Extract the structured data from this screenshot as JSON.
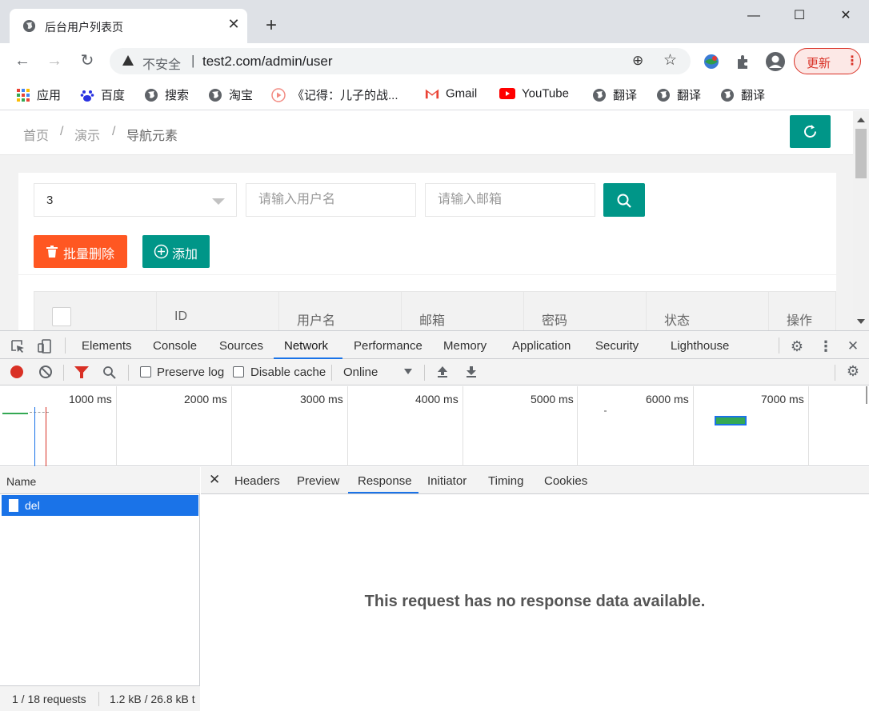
{
  "browser": {
    "tab_title": "后台用户列表页",
    "new_tab": "+",
    "window_controls": {
      "minimize": "—",
      "maximize": "☐",
      "close": "✕"
    },
    "security_label": "不安全",
    "url": "test2.com/admin/user",
    "update_label": "更新"
  },
  "bookmarks": [
    {
      "label": "应用",
      "icon": "apps-grid-icon"
    },
    {
      "label": "百度",
      "icon": "baidu-paw-icon"
    },
    {
      "label": "搜索",
      "icon": "globe-icon"
    },
    {
      "label": "淘宝",
      "icon": "globe-icon"
    },
    {
      "label": "《记得：儿子的战...",
      "icon": "play-circle-icon"
    },
    {
      "label": "Gmail",
      "icon": "gmail-icon"
    },
    {
      "label": "YouTube",
      "icon": "youtube-icon"
    },
    {
      "label": "翻译",
      "icon": "globe-icon"
    },
    {
      "label": "翻译",
      "icon": "globe-icon"
    },
    {
      "label": "翻译",
      "icon": "globe-icon"
    }
  ],
  "page": {
    "breadcrumb": [
      "首页",
      "演示",
      "导航元素"
    ],
    "breadcrumb_sep": "/",
    "filter": {
      "select_value": "3",
      "username_placeholder": "请输入用户名",
      "email_placeholder": "请输入邮箱"
    },
    "buttons": {
      "batch_delete": "批量删除",
      "add": "添加"
    },
    "table_headers": [
      "ID",
      "用户名",
      "邮箱",
      "密码",
      "状态",
      "操作"
    ],
    "accent_color": "#009688",
    "danger_color": "#ff5722"
  },
  "devtools": {
    "tabs": [
      "Elements",
      "Console",
      "Sources",
      "Network",
      "Performance",
      "Memory",
      "Application",
      "Security",
      "Lighthouse"
    ],
    "active_tab": "Network",
    "toolbar": {
      "preserve_log": "Preserve log",
      "disable_cache": "Disable cache",
      "throttling": "Online"
    },
    "timeline_labels": [
      "1000 ms",
      "2000 ms",
      "3000 ms",
      "4000 ms",
      "5000 ms",
      "6000 ms",
      "7000 ms"
    ],
    "name_header": "Name",
    "requests": [
      {
        "name": "del"
      }
    ],
    "detail_tabs": [
      "Headers",
      "Preview",
      "Response",
      "Initiator",
      "Timing",
      "Cookies"
    ],
    "active_detail_tab": "Response",
    "no_response_text": "This request has no response data available.",
    "status": {
      "requests": "1 / 18 requests",
      "transferred": "1.2 kB / 26.8 kB t"
    }
  }
}
